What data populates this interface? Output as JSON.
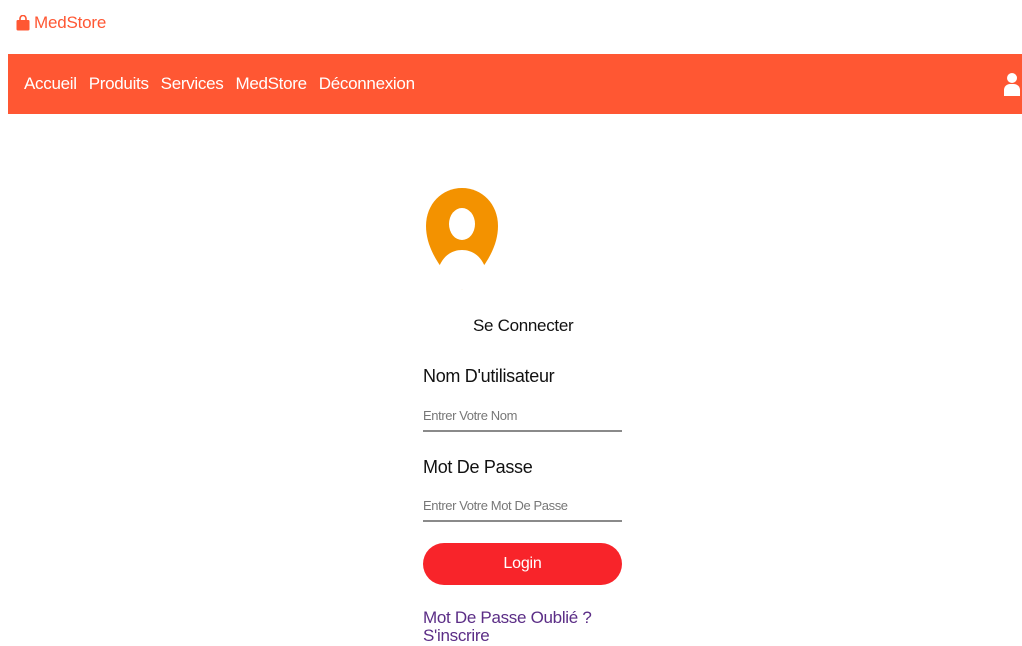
{
  "brand": {
    "name": "MedStore",
    "icon": "shopping-bag-icon",
    "color": "#ff5733"
  },
  "navbar": {
    "background": "#ff5733",
    "items": [
      {
        "label": "Accueil"
      },
      {
        "label": "Produits"
      },
      {
        "label": "Services"
      },
      {
        "label": "MedStore"
      },
      {
        "label": "Déconnexion"
      }
    ],
    "user_icon": "user-icon"
  },
  "login": {
    "avatar_icon": "user-avatar-icon",
    "title": "Se Connecter",
    "username_label": "Nom D'utilisateur",
    "username_placeholder": "Entrer Votre Nom",
    "password_label": "Mot De Passe",
    "password_placeholder": "Entrer Votre Mot De Passe",
    "button_label": "Login",
    "button_color": "#f8242a",
    "forgot_link": "Mot De Passe Oublié ?",
    "signup_link": "S'inscrire",
    "link_color": "#5b2d86"
  }
}
